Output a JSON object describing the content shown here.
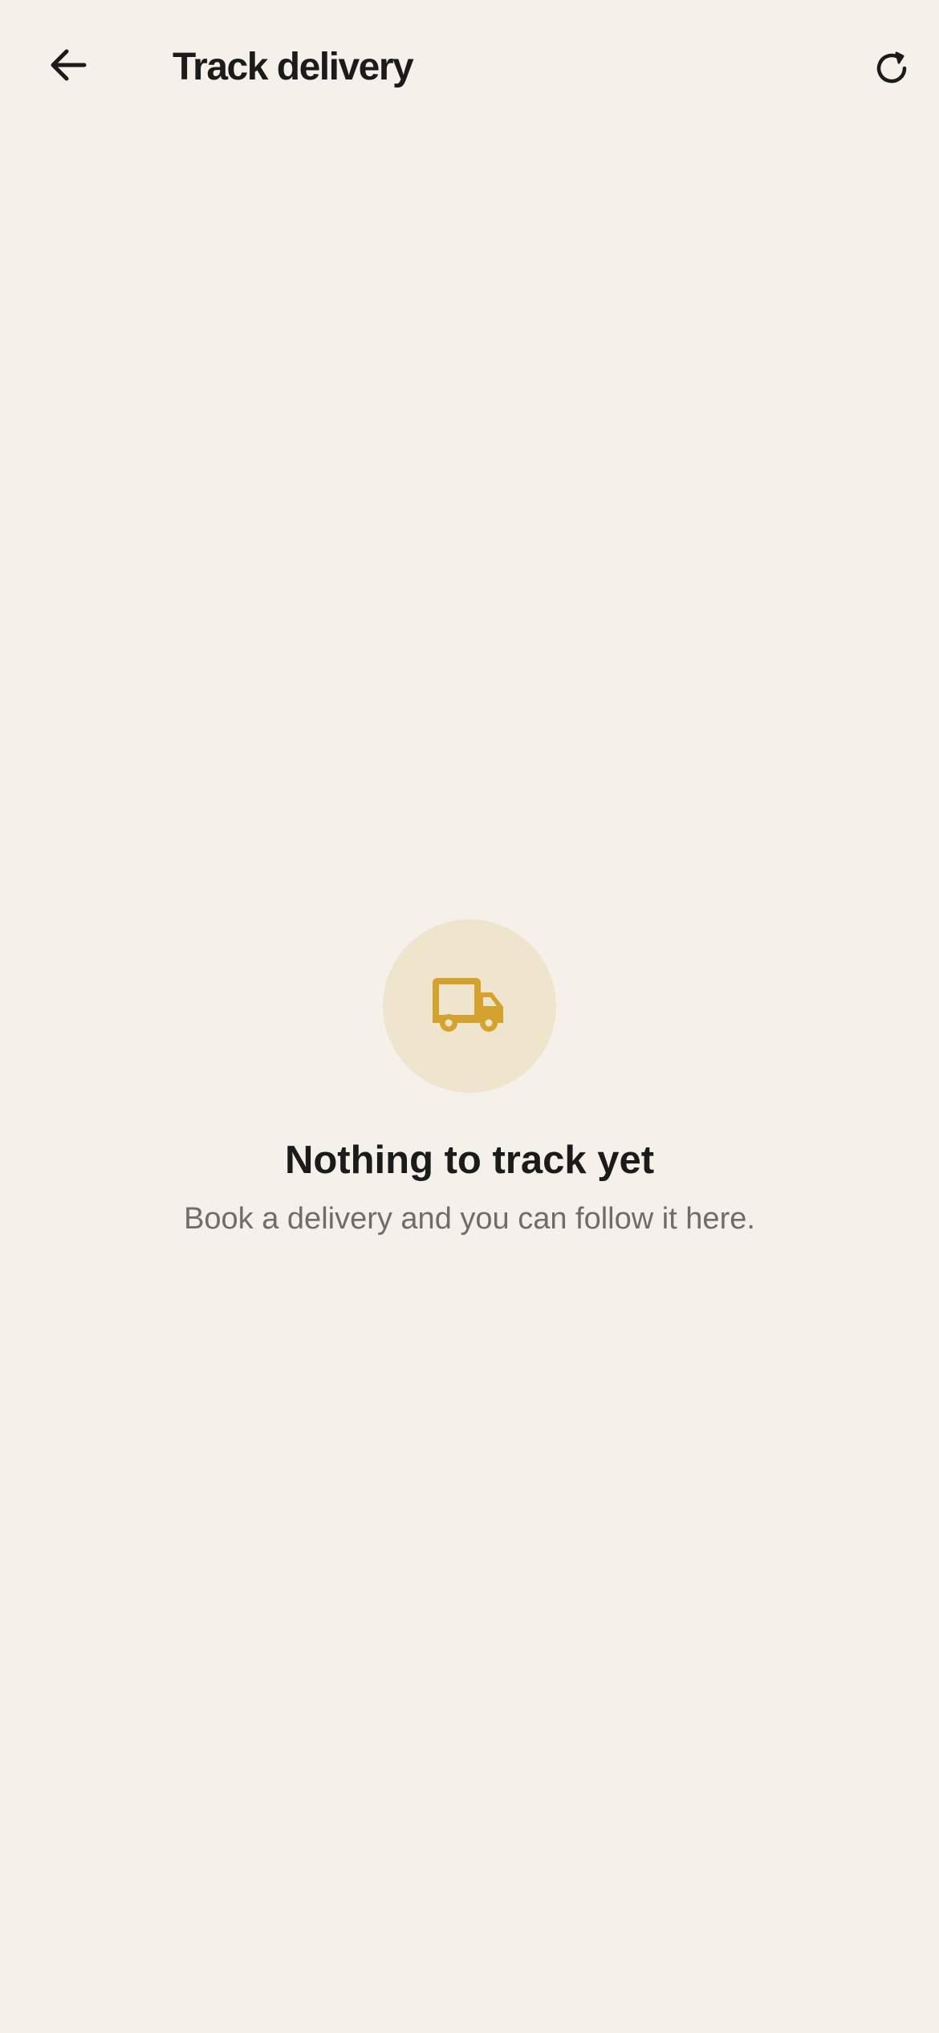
{
  "header": {
    "title": "Track delivery",
    "back_icon": "arrow-left-icon",
    "refresh_icon": "refresh-icon"
  },
  "empty_state": {
    "icon": "truck-icon",
    "title": "Nothing to track yet",
    "subtitle": "Book a delivery and you can follow it here."
  },
  "colors": {
    "background": "#f5f1ea",
    "accent": "#d4a22e",
    "icon_circle": "#efe4cc",
    "title_text": "#1b1b1b",
    "subtitle_text": "#6e6d6a"
  }
}
